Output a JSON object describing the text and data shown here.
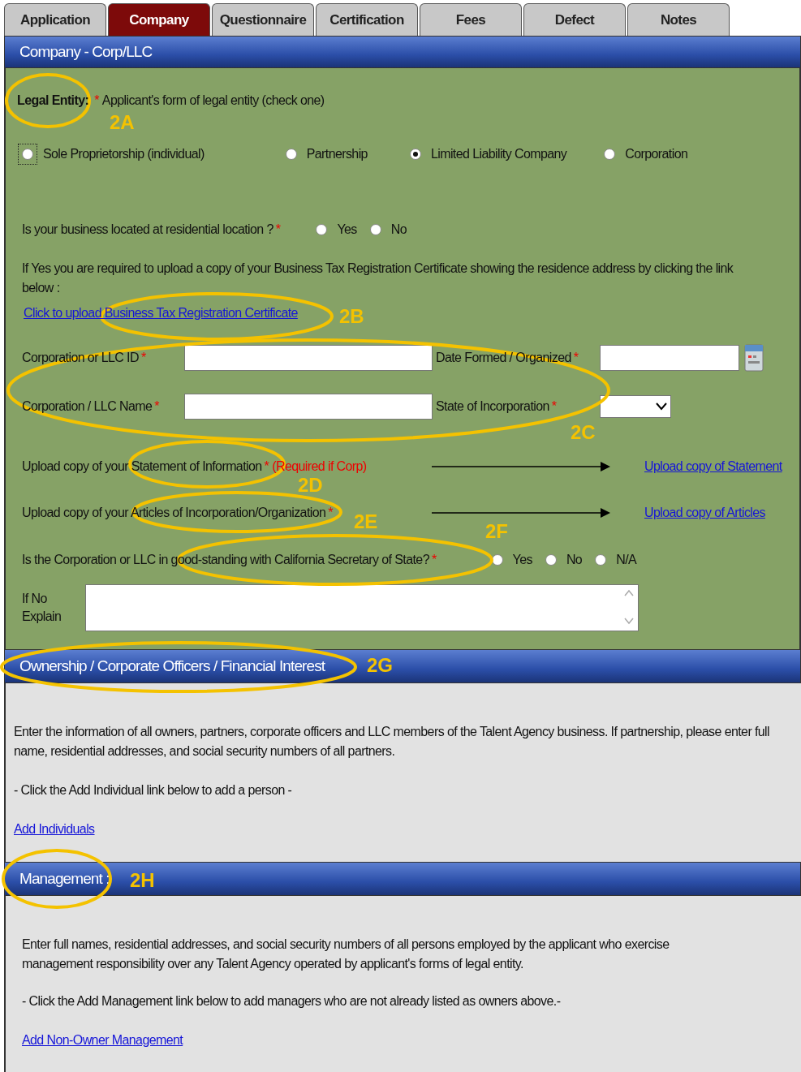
{
  "tabs": [
    {
      "label": "Application",
      "selected": false
    },
    {
      "label": "Company",
      "selected": true
    },
    {
      "label": "Questionnaire",
      "selected": false
    },
    {
      "label": "Certification",
      "selected": false
    },
    {
      "label": "Fees",
      "selected": false
    },
    {
      "label": "Defect",
      "selected": false
    },
    {
      "label": "Notes",
      "selected": false
    }
  ],
  "company": {
    "title": "Company - Corp/LLC",
    "legal_entity": {
      "label": "Legal Entity:",
      "required": "*",
      "hint": "Applicant's form of legal entity (check one)",
      "options": [
        {
          "label": "Sole Proprietorship (individual)",
          "selected": false,
          "focused": true
        },
        {
          "label": "Partnership",
          "selected": false,
          "focused": false
        },
        {
          "label": "Limited Liability Company",
          "selected": true,
          "focused": false
        },
        {
          "label": "Corporation",
          "selected": false,
          "focused": false
        }
      ]
    },
    "residential": {
      "question": "Is your business located at residential location ?",
      "required": "*",
      "options": [
        {
          "label": "Yes",
          "selected": false
        },
        {
          "label": "No",
          "selected": false
        }
      ]
    },
    "upload_note": "If Yes you are required to upload a copy of your Business Tax Registration Certificate showing the residence address by clicking the link below :",
    "upload_link": "Click to upload Business Tax Registration Certificate",
    "fields": [
      {
        "label": "Corporation or LLC ID",
        "required": "*",
        "kind": "text"
      },
      {
        "label": "Date Formed / Organized",
        "required": "*",
        "kind": "date"
      },
      {
        "label": "Corporation / LLC Name",
        "required": "*",
        "kind": "text"
      },
      {
        "label": "State of Incorporation",
        "required": "*",
        "kind": "select"
      }
    ],
    "uploads": [
      {
        "prefix": "Upload copy of your",
        "document": "Statement of Information",
        "required": "*",
        "note": "(Required if Corp)",
        "link": "Upload copy of Statement"
      },
      {
        "prefix": "Upload copy of your",
        "document": "Articles of Incorporation/Organization",
        "required": "*",
        "link": "Upload copy of Articles"
      }
    ],
    "good_standing": {
      "question": "Is the Corporation or LLC in good-standing with California Secretary of State?",
      "required": "*",
      "options": [
        {
          "label": "Yes",
          "selected": false
        },
        {
          "label": "No",
          "selected": false
        },
        {
          "label": "N/A",
          "selected": false
        }
      ]
    },
    "explain": {
      "label_1": "If No",
      "label_2": "Explain"
    }
  },
  "ownership": {
    "title": "Ownership / Corporate Officers / Financial Interest",
    "description": "Enter the information of all owners, partners, corporate officers and LLC members of the Talent Agency business. If partnership, please enter full name, residential addresses, and social security numbers of all partners.",
    "instruction": "- Click the Add Individual link below to add a person -",
    "link": "Add Individuals"
  },
  "management": {
    "title": "Management :",
    "description": "Enter full names, residential addresses, and social security numbers of all persons employed by the applicant who exercise management responsibility over any Talent Agency operated by applicant's forms of legal entity.",
    "instruction": "- Click the Add Management link below to add managers who are not already listed as owners above.-",
    "link": "Add Non-Owner Management"
  },
  "annotations": [
    {
      "label": "2A"
    },
    {
      "label": "2B"
    },
    {
      "label": "2C"
    },
    {
      "label": "2D"
    },
    {
      "label": "2E"
    },
    {
      "label": "2F"
    },
    {
      "label": "2G"
    },
    {
      "label": "2H"
    }
  ]
}
